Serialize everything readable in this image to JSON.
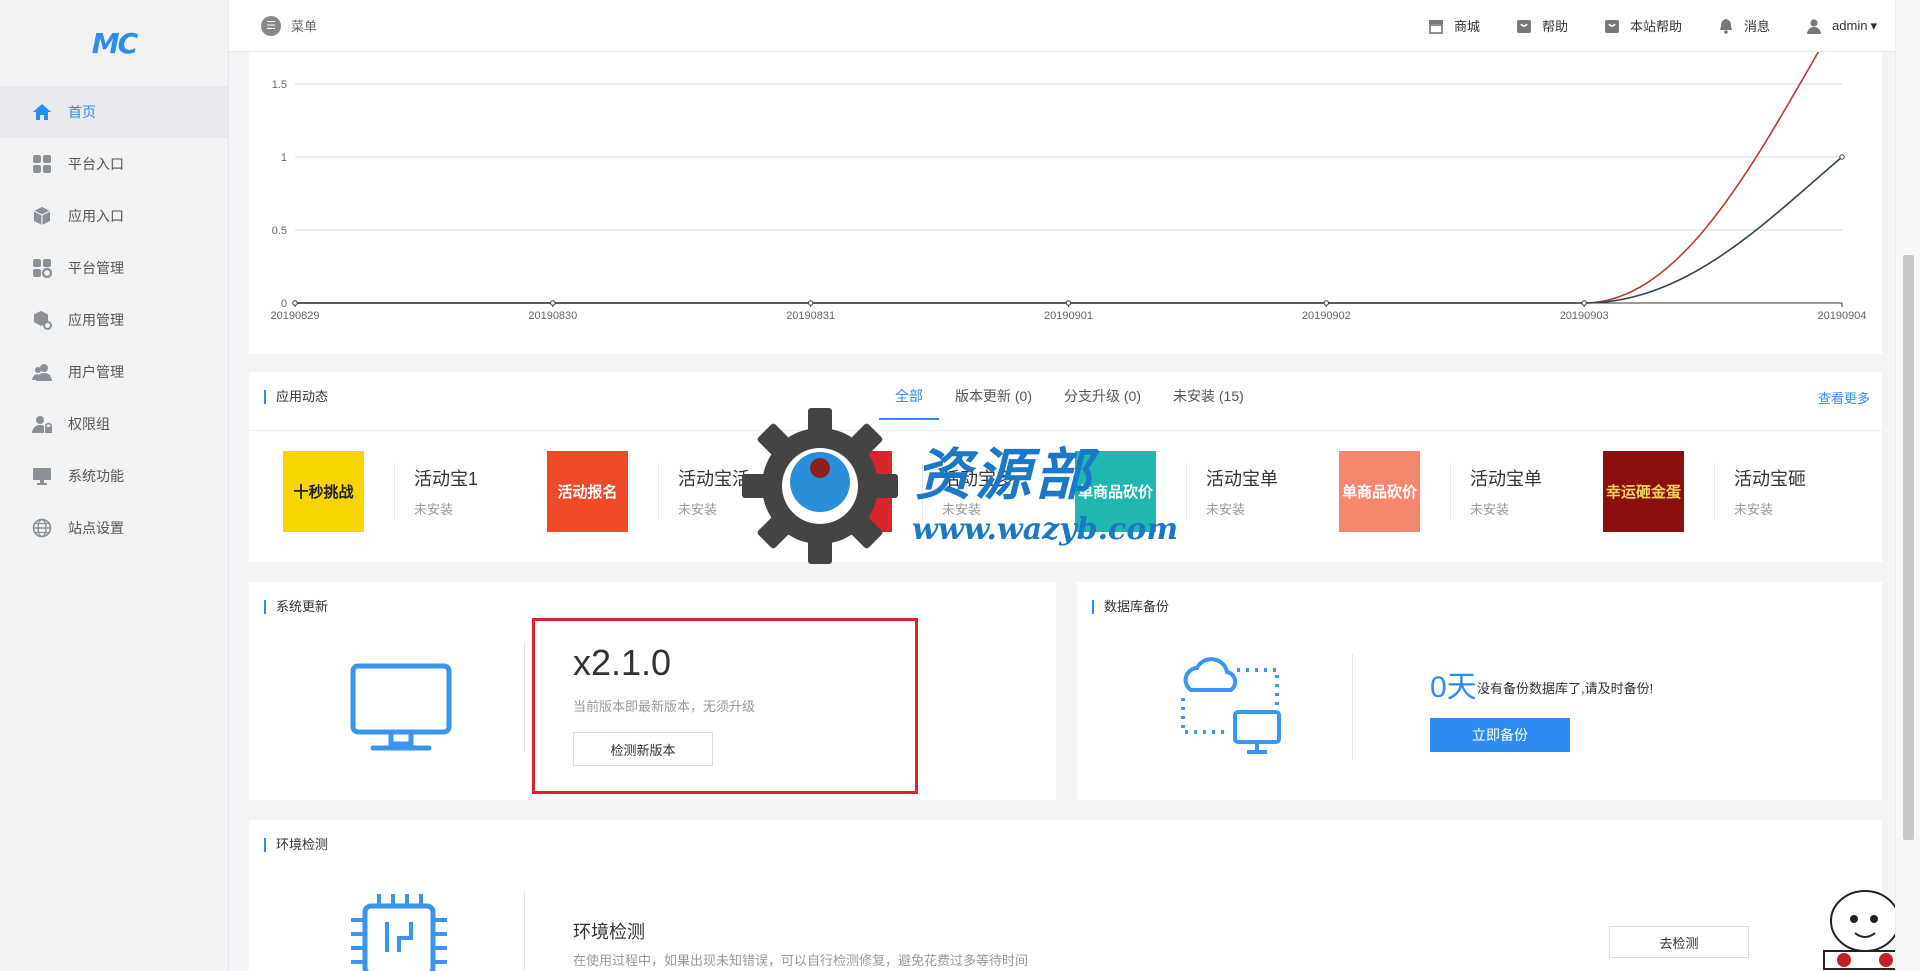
{
  "sidebar": {
    "logo": "MC",
    "items": [
      {
        "label": "首页",
        "icon": "home-icon",
        "active": true
      },
      {
        "label": "平台入口",
        "icon": "grid-icon"
      },
      {
        "label": "应用入口",
        "icon": "cube-icon"
      },
      {
        "label": "平台管理",
        "icon": "grid-gear-icon"
      },
      {
        "label": "应用管理",
        "icon": "cube-gear-icon"
      },
      {
        "label": "用户管理",
        "icon": "users-icon"
      },
      {
        "label": "权限组",
        "icon": "user-lock-icon"
      },
      {
        "label": "系统功能",
        "icon": "monitor-icon"
      },
      {
        "label": "站点设置",
        "icon": "globe-icon"
      }
    ]
  },
  "topbar": {
    "menu_label": "菜单",
    "links": [
      {
        "label": "商城",
        "icon": "store-icon"
      },
      {
        "label": "帮助",
        "icon": "help-bag-icon"
      },
      {
        "label": "本站帮助",
        "icon": "help-bag-icon"
      },
      {
        "label": "消息",
        "icon": "bell-icon"
      },
      {
        "label": "admin",
        "icon": "user-icon"
      }
    ]
  },
  "chart_data": {
    "type": "line",
    "x": [
      "20190829",
      "20190830",
      "20190831",
      "20190901",
      "20190902",
      "20190903",
      "20190904"
    ],
    "yticks": [
      "0",
      "0.5",
      "1",
      "1.5"
    ],
    "ylim": [
      0,
      1.5
    ],
    "grid": true,
    "series": [
      {
        "color": "#c23531",
        "values": [
          0,
          0,
          0,
          0,
          0,
          0,
          2
        ]
      },
      {
        "color": "#2f4554",
        "values": [
          0,
          0,
          0,
          0,
          0,
          0,
          1
        ]
      }
    ]
  },
  "activity": {
    "title": "应用动态",
    "tabs": [
      {
        "label": "全部",
        "active": true
      },
      {
        "label": "版本更新 (0)"
      },
      {
        "label": "分支升级 (0)"
      },
      {
        "label": "未安装 (15)"
      }
    ],
    "more": "查看更多",
    "apps": [
      {
        "name": "活动宝1",
        "status": "未安装",
        "thumb": "十秒挑战",
        "bg": "#f7d600",
        "fg": "#222"
      },
      {
        "name": "活动宝活",
        "status": "未安装",
        "thumb": "活动报名",
        "bg": "#ef4a2a",
        "fg": "#fff"
      },
      {
        "name": "活动宝多",
        "status": "未安装",
        "thumb": "砍价",
        "bg": "#d8242a",
        "fg": "#fff"
      },
      {
        "name": "活动宝单",
        "status": "未安装",
        "thumb": "单商品砍价",
        "bg": "#1fb7b0",
        "fg": "#fff"
      },
      {
        "name": "活动宝单",
        "status": "未安装",
        "thumb": "单商品砍价",
        "bg": "#f6876e",
        "fg": "#fff"
      },
      {
        "name": "活动宝砸",
        "status": "未安装",
        "thumb": "幸运砸金蛋",
        "bg": "#8a1010",
        "fg": "#f4d35e"
      }
    ]
  },
  "system_update": {
    "title": "系统更新",
    "version": "x2.1.0",
    "desc": "当前版本即最新版本，无须升级",
    "button": "检测新版本"
  },
  "backup": {
    "title": "数据库备份",
    "days": "0天",
    "text": "没有备份数据库了,请及时备份!",
    "button": "立即备份"
  },
  "env": {
    "title": "环境检测",
    "heading": "环境检测",
    "desc": "在使用过程中，如果出现未知错误，可以自行检测修复，避免花费过多等待时间",
    "button": "去检测"
  },
  "watermark": {
    "text": "资源部",
    "url": "www.wazyb.com"
  }
}
